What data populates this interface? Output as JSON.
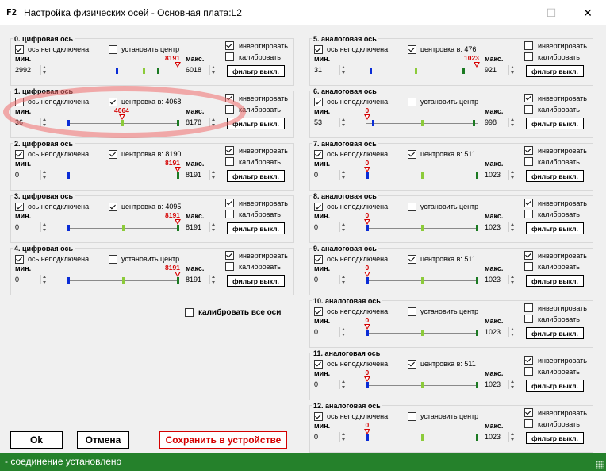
{
  "window": {
    "icon_text": "F2",
    "title": "Настройка физических осей - Основная плата:L2",
    "minimize": "—",
    "maximize": "☐",
    "close": "✕"
  },
  "labels": {
    "not_connected": "ось неподключена",
    "set_center": "установить центр",
    "min": "мин.",
    "max": "макс.",
    "invert": "инвертировать",
    "calibrate": "калибровать",
    "filter_off": "фильтр выкл."
  },
  "axes": [
    {
      "title": "0. цифровая ось",
      "not_connected": true,
      "center_checked": false,
      "center_text": "установить центр",
      "min": "2992",
      "max": "6018",
      "value_label": "8191",
      "invert": true,
      "calibrate": false,
      "pos": {
        "min": 0.44,
        "center": 0.69,
        "max": 0.82,
        "cur": 1.0
      }
    },
    {
      "title": "1. цифровая ось",
      "not_connected": false,
      "center_checked": true,
      "center_text": "центровка в: 4068",
      "min": "36",
      "max": "8178",
      "value_label": "4064",
      "invert": true,
      "calibrate": false,
      "pos": {
        "min": 0.0,
        "center": 0.49,
        "max": 1.0,
        "cur": 0.49
      }
    },
    {
      "title": "2. цифровая ось",
      "not_connected": true,
      "center_checked": true,
      "center_text": "центровка в: 8190",
      "min": "0",
      "max": "8191",
      "value_label": "8191",
      "invert": true,
      "calibrate": false,
      "pos": {
        "min": 0.0,
        "center": 1.0,
        "max": 1.0,
        "cur": 1.0
      }
    },
    {
      "title": "3. цифровая ось",
      "not_connected": true,
      "center_checked": true,
      "center_text": "центровка в: 4095",
      "min": "0",
      "max": "8191",
      "value_label": "8191",
      "invert": true,
      "calibrate": false,
      "pos": {
        "min": 0.0,
        "center": 0.5,
        "max": 1.0,
        "cur": 1.0
      }
    },
    {
      "title": "4. цифровая ось",
      "not_connected": true,
      "center_checked": false,
      "center_text": "установить центр",
      "min": "0",
      "max": "8191",
      "value_label": "8191",
      "invert": true,
      "calibrate": false,
      "pos": {
        "min": 0.0,
        "center": 0.5,
        "max": 1.0,
        "cur": 1.0
      }
    },
    {
      "title": "5. аналоговая ось",
      "not_connected": true,
      "center_checked": true,
      "center_text": "центровка в: 476",
      "min": "31",
      "max": "921",
      "value_label": "1023",
      "invert": false,
      "calibrate": false,
      "pos": {
        "min": 0.03,
        "center": 0.44,
        "max": 0.88,
        "cur": 1.0
      }
    },
    {
      "title": "6. аналоговая ось",
      "not_connected": true,
      "center_checked": false,
      "center_text": "установить центр",
      "min": "53",
      "max": "998",
      "value_label": "0",
      "invert": true,
      "calibrate": false,
      "pos": {
        "min": 0.05,
        "center": 0.5,
        "max": 0.97,
        "cur": 0.0
      }
    },
    {
      "title": "7. аналоговая ось",
      "not_connected": true,
      "center_checked": true,
      "center_text": "центровка в: 511",
      "min": "0",
      "max": "1023",
      "value_label": "0",
      "invert": true,
      "calibrate": false,
      "pos": {
        "min": 0.0,
        "center": 0.5,
        "max": 1.0,
        "cur": 0.0
      }
    },
    {
      "title": "8. аналоговая ось",
      "not_connected": true,
      "center_checked": false,
      "center_text": "установить центр",
      "min": "0",
      "max": "1023",
      "value_label": "0",
      "invert": true,
      "calibrate": false,
      "pos": {
        "min": 0.0,
        "center": 0.5,
        "max": 1.0,
        "cur": 0.0
      }
    },
    {
      "title": "9. аналоговая ось",
      "not_connected": true,
      "center_checked": true,
      "center_text": "центровка в: 511",
      "min": "0",
      "max": "1023",
      "value_label": "0",
      "invert": true,
      "calibrate": false,
      "pos": {
        "min": 0.0,
        "center": 0.5,
        "max": 1.0,
        "cur": 0.0
      }
    },
    {
      "title": "10. аналоговая ось",
      "not_connected": true,
      "center_checked": false,
      "center_text": "установить центр",
      "min": "0",
      "max": "1023",
      "value_label": "0",
      "invert": false,
      "calibrate": false,
      "pos": {
        "min": 0.0,
        "center": 0.5,
        "max": 1.0,
        "cur": 0.0
      }
    },
    {
      "title": "11. аналоговая ось",
      "not_connected": true,
      "center_checked": true,
      "center_text": "центровка в: 511",
      "min": "0",
      "max": "1023",
      "value_label": "0",
      "invert": true,
      "calibrate": false,
      "pos": {
        "min": 0.0,
        "center": 0.5,
        "max": 1.0,
        "cur": 0.0
      }
    },
    {
      "title": "12. аналоговая ось",
      "not_connected": true,
      "center_checked": false,
      "center_text": "установить центр",
      "min": "0",
      "max": "1023",
      "value_label": "0",
      "invert": true,
      "calibrate": false,
      "pos": {
        "min": 0.0,
        "center": 0.5,
        "max": 1.0,
        "cur": 0.0
      }
    }
  ],
  "calibrate_all": {
    "label": "калибровать все оси",
    "checked": false
  },
  "buttons": {
    "ok": "Ok",
    "cancel": "Отмена",
    "save": "Сохранить в устройстве"
  },
  "status": {
    "text": "- соединение установлено"
  },
  "colors": {
    "status_bg": "#25812b",
    "current_marker": "#d40000",
    "min_marker": "#0a2cd6",
    "center_marker": "#8ccb3a",
    "max_marker": "#1b7a22"
  }
}
